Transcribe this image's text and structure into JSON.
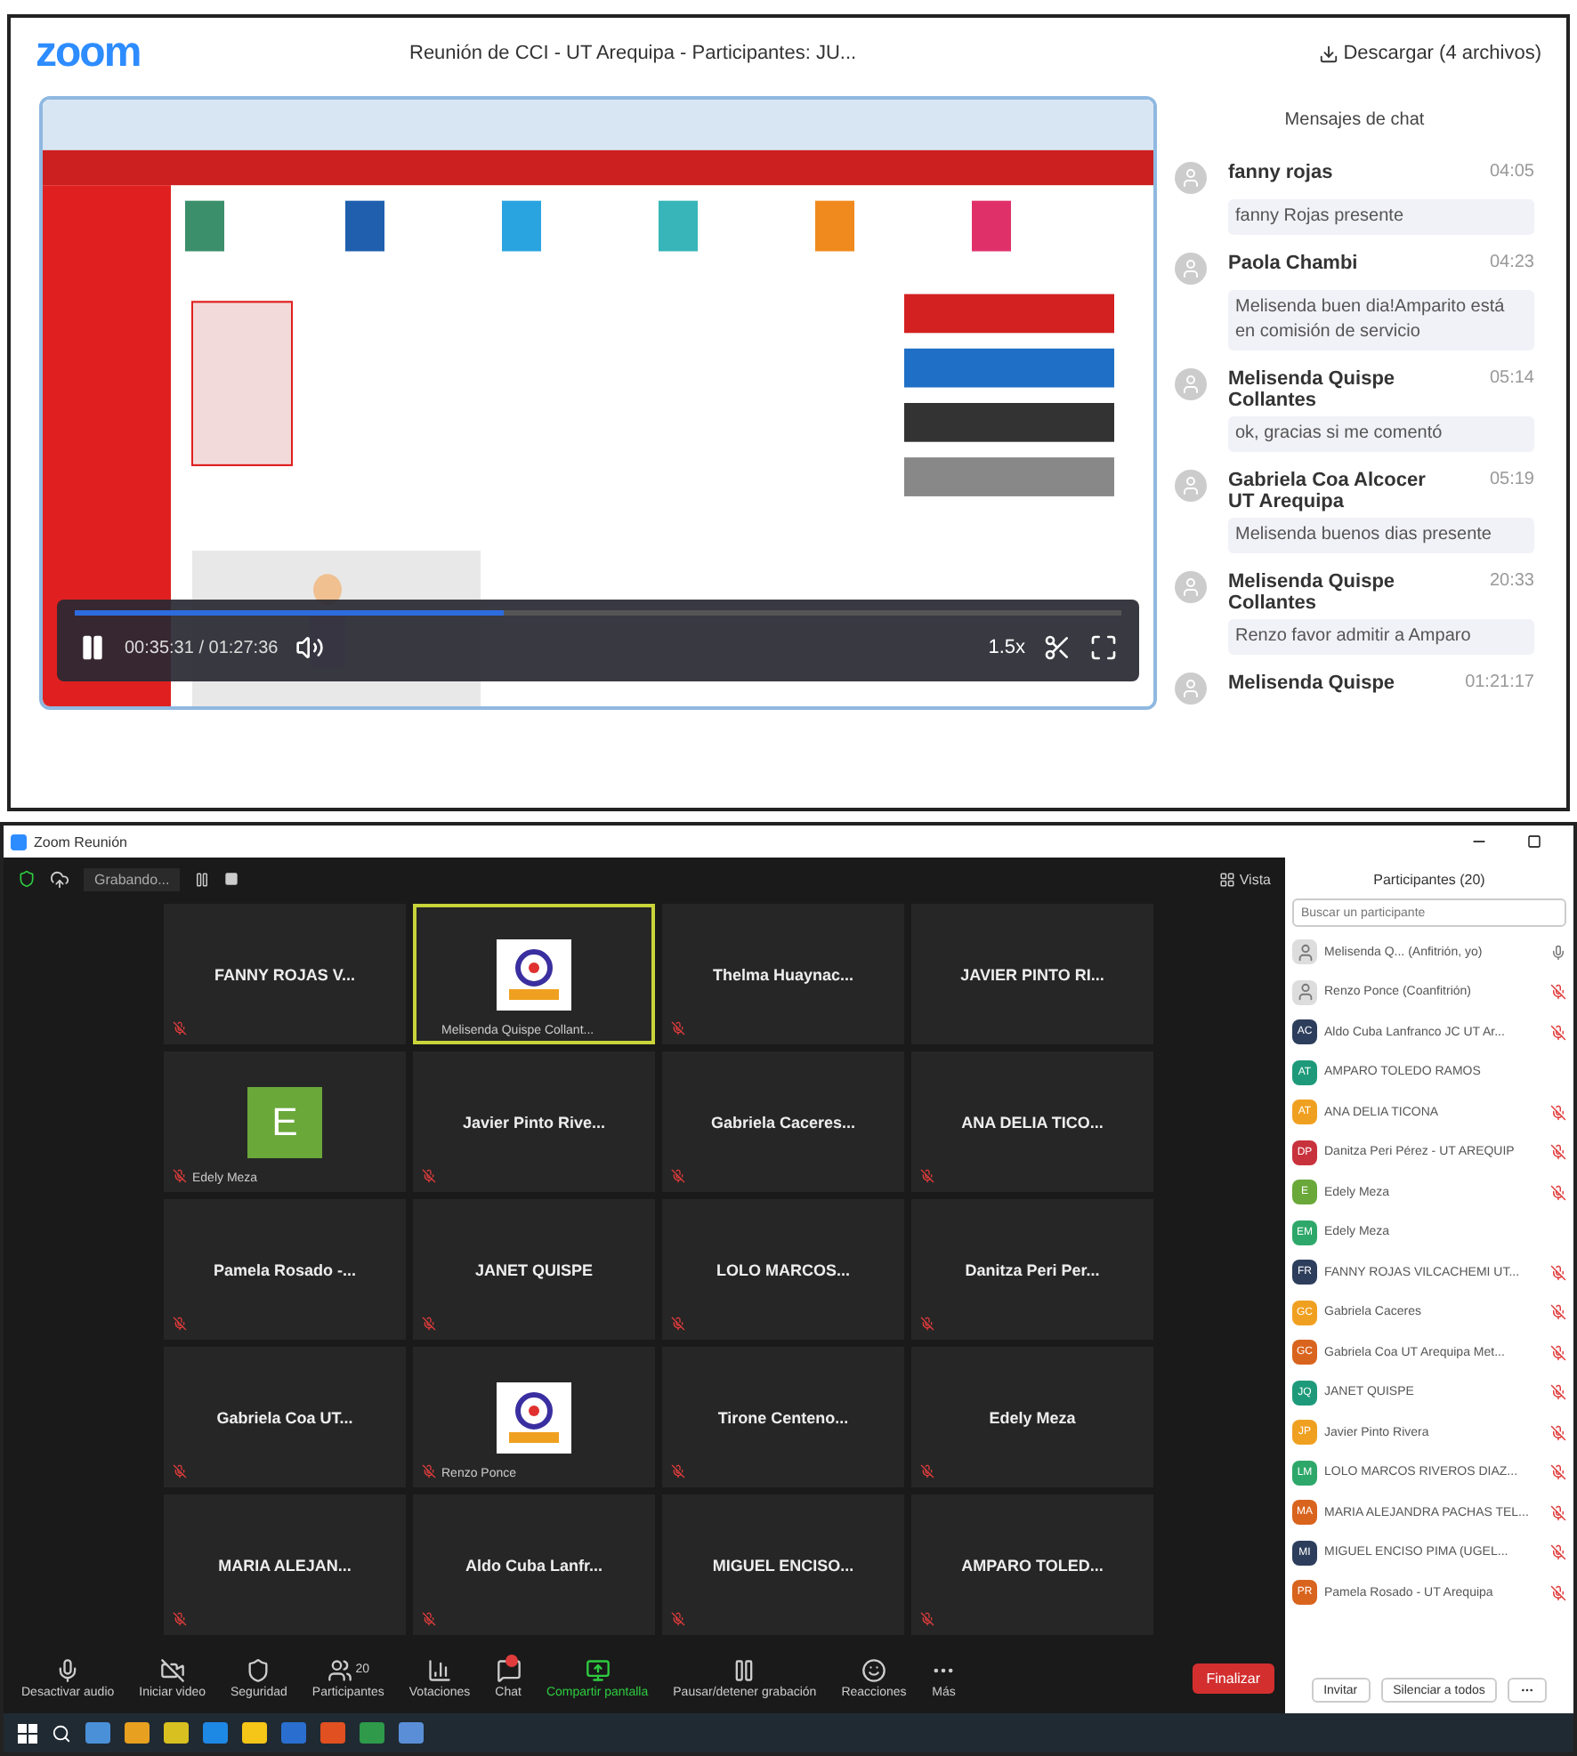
{
  "recording_viewer": {
    "logo": "zoom",
    "title": "Reunión de CCI - UT Arequipa - Participantes: JU...",
    "download": "Descargar (4 archivos)",
    "player": {
      "time": "00:35:31 / 01:27:36",
      "level": 0.41,
      "speed": "1.5x",
      "playing": true
    },
    "chat": {
      "title": "Mensajes de chat",
      "messages": [
        {
          "sender": "fanny rojas",
          "time": "04:05",
          "text": "fanny Rojas presente"
        },
        {
          "sender": "Paola Chambi",
          "time": "04:23",
          "text": "Melisenda buen dia!Amparito está en comisión de servicio"
        },
        {
          "sender": "Melisenda Quispe Collantes",
          "time": "05:14",
          "text": "ok, gracias si me comentó"
        },
        {
          "sender": "Gabriela Coa Alcocer UT Arequipa",
          "time": "05:19",
          "text": "Melisenda buenos dias presente"
        },
        {
          "sender": "Melisenda Quispe Collantes",
          "time": "20:33",
          "text": "Renzo favor admitir a Amparo"
        },
        {
          "sender": "Melisenda Quispe",
          "time": "01:21:17"
        }
      ]
    }
  },
  "meeting": {
    "window_title": "Zoom Reunión",
    "recording": "Grabando...",
    "view": "Vista",
    "tiles": [
      {
        "kind": "name",
        "name": "FANNY ROJAS V...",
        "muted": true,
        "active": false
      },
      {
        "kind": "logo",
        "label": "Melisenda Quispe Collant...",
        "muted": false,
        "active": true
      },
      {
        "kind": "name",
        "name": "Thelma Huaynac...",
        "muted": true,
        "active": false
      },
      {
        "kind": "name",
        "name": "JAVIER PINTO RI...",
        "muted": false,
        "active": false
      },
      {
        "kind": "initial",
        "name": "E",
        "label": "Edely Meza",
        "muted": true,
        "active": false
      },
      {
        "kind": "name",
        "name": "Javier Pinto Rive...",
        "muted": true,
        "active": false
      },
      {
        "kind": "name",
        "name": "Gabriela Caceres...",
        "muted": true,
        "active": false
      },
      {
        "kind": "name",
        "name": "ANA DELIA TICO...",
        "muted": true,
        "active": false
      },
      {
        "kind": "name",
        "name": "Pamela Rosado -...",
        "muted": true,
        "active": false
      },
      {
        "kind": "name",
        "name": "JANET QUISPE",
        "muted": true,
        "active": false
      },
      {
        "kind": "name",
        "name": "LOLO MARCOS...",
        "muted": true,
        "active": false
      },
      {
        "kind": "name",
        "name": "Danitza Peri Per...",
        "muted": true,
        "active": false
      },
      {
        "kind": "name",
        "name": "Gabriela Coa UT...",
        "muted": true,
        "active": false
      },
      {
        "kind": "logo",
        "label": "Renzo Ponce",
        "muted": true,
        "active": false
      },
      {
        "kind": "name",
        "name": "Tirone Centeno...",
        "muted": true,
        "active": false
      },
      {
        "kind": "name",
        "name": "Edely Meza",
        "muted": true,
        "active": false
      },
      {
        "kind": "name",
        "name": "MARIA ALEJAN...",
        "muted": true,
        "active": false
      },
      {
        "kind": "name",
        "name": "Aldo Cuba Lanfr...",
        "muted": true,
        "active": false
      },
      {
        "kind": "name",
        "name": "MIGUEL ENCISO...",
        "muted": true,
        "active": false
      },
      {
        "kind": "name",
        "name": "AMPARO TOLED...",
        "muted": true,
        "active": false
      }
    ],
    "toolbar": [
      {
        "kind": "mic",
        "label": "Desactivar audio"
      },
      {
        "kind": "video",
        "label": "Iniciar video"
      },
      {
        "kind": "security",
        "label": "Seguridad"
      },
      {
        "kind": "participants",
        "label": "Participantes",
        "count": "20"
      },
      {
        "kind": "polls",
        "label": "Votaciones"
      },
      {
        "kind": "chat",
        "label": "Chat"
      },
      {
        "kind": "share",
        "label": "Compartir pantalla"
      },
      {
        "kind": "record",
        "label": "Pausar/detener grabación"
      },
      {
        "kind": "reactions",
        "label": "Reacciones"
      },
      {
        "kind": "more",
        "label": "Más"
      }
    ],
    "end_button": "Finalizar",
    "participants": {
      "title": "Participantes (20)",
      "search": {
        "placeholder": "Buscar un participante"
      },
      "items": [
        {
          "name": "Melisenda Q... (Anfitrión, yo)",
          "muted": false
        },
        {
          "name": "Renzo Ponce (Coanfitrión)",
          "muted": true
        },
        {
          "kind": "initials",
          "initials": "AC",
          "color": "#2d3e5c",
          "name": "Aldo Cuba Lanfranco JC UT Ar...",
          "muted": true
        },
        {
          "kind": "initials",
          "initials": "AT",
          "color": "#1e9a7a",
          "name": "AMPARO TOLEDO RAMOS"
        },
        {
          "kind": "initials",
          "initials": "AT",
          "color": "#f0a020",
          "name": "ANA DELIA TICONA",
          "muted": true
        },
        {
          "kind": "initials",
          "initials": "DP",
          "color": "#c8323c",
          "name": "Danitza Peri Pérez - UT AREQUIP",
          "muted": true
        },
        {
          "kind": "initials",
          "initials": "E",
          "color": "#6aa83a",
          "name": "Edely Meza",
          "muted": true
        },
        {
          "kind": "initials",
          "initials": "EM",
          "color": "#2ea86a",
          "name": "Edely Meza"
        },
        {
          "kind": "initials",
          "initials": "FR",
          "color": "#2d3e5c",
          "name": "FANNY ROJAS VILCACHEMI UT...",
          "muted": true
        },
        {
          "kind": "initials",
          "initials": "GC",
          "color": "#f0a020",
          "name": "Gabriela Caceres",
          "muted": true
        },
        {
          "kind": "initials",
          "initials": "GC",
          "color": "#d9641e",
          "name": "Gabriela Coa UT Arequipa Met...",
          "muted": true
        },
        {
          "kind": "initials",
          "initials": "JQ",
          "color": "#1e9a7a",
          "name": "JANET QUISPE",
          "muted": true
        },
        {
          "kind": "initials",
          "initials": "JP",
          "color": "#f0a020",
          "name": "Javier Pinto Rivera",
          "muted": true
        },
        {
          "kind": "initials",
          "initials": "LM",
          "color": "#2ea86a",
          "name": "LOLO MARCOS RIVEROS DIAZ...",
          "muted": true
        },
        {
          "kind": "initials",
          "initials": "MA",
          "color": "#d9641e",
          "name": "MARIA ALEJANDRA PACHAS TEL...",
          "muted": true
        },
        {
          "kind": "initials",
          "initials": "MI",
          "color": "#2d3e5c",
          "name": "MIGUEL ENCISO PIMA (UGEL...",
          "muted": true
        },
        {
          "kind": "initials",
          "initials": "PR",
          "color": "#d9641e",
          "name": "Pamela Rosado - UT Arequipa",
          "muted": true
        }
      ],
      "buttons": [
        "Invitar",
        "Silenciar a todos"
      ]
    }
  }
}
